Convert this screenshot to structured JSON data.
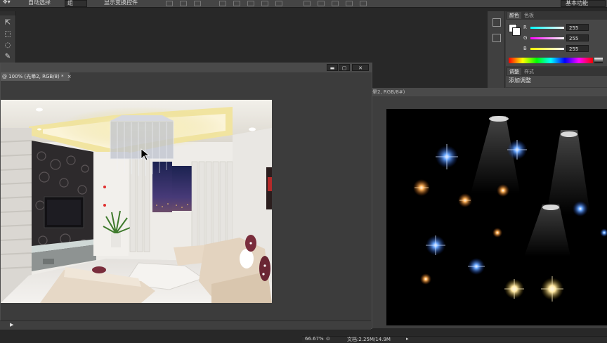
{
  "options_bar": {
    "auto_select_label": "自动选择",
    "auto_select_value": "组",
    "show_transform_controls": "显示变换控件",
    "workspace": "基本功能"
  },
  "color_panel": {
    "tabs": [
      "颜色",
      "色板"
    ],
    "r_label": "R",
    "g_label": "G",
    "b_label": "B",
    "r_value": "255",
    "g_value": "255",
    "b_value": "255"
  },
  "adjust_panel": {
    "tabs": [
      "调整",
      "样式"
    ],
    "add_adjustment": "添加调整"
  },
  "document1": {
    "tab_title": "@ 100% (光晕2, RGB/8) *",
    "tab_close": "×",
    "min_btn": "▬",
    "max_btn": "▢",
    "close_btn": "✕"
  },
  "document2": {
    "tab_title": "晕2, RGB/8#)"
  },
  "status": {
    "zoom": "66.67%",
    "doc_info": "文档:2.25M/14.9M"
  },
  "colors": {
    "accent": "#1f6fd1",
    "panel_bg": "#3a3a3a",
    "app_bg": "#282828"
  }
}
